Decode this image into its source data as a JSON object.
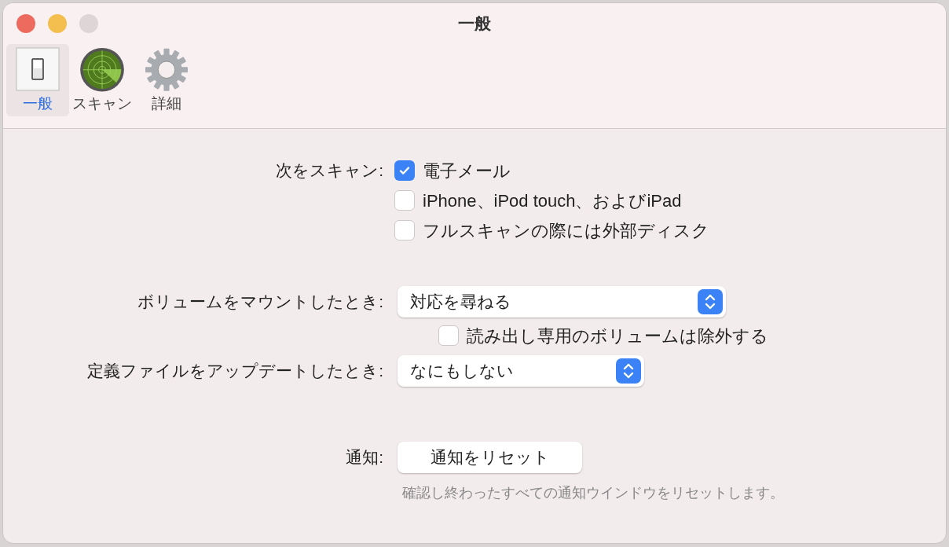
{
  "window": {
    "title": "一般"
  },
  "toolbar": [
    {
      "kind": "switch",
      "label": "一般",
      "selected": true
    },
    {
      "kind": "radar",
      "label": "スキャン",
      "selected": false
    },
    {
      "kind": "gear",
      "label": "詳細",
      "selected": false
    }
  ],
  "scan": {
    "label": "次をスキャン:",
    "options": [
      {
        "label": "電子メール",
        "checked": true
      },
      {
        "label": "iPhone、iPod touch、およびiPad",
        "checked": false
      },
      {
        "label": "フルスキャンの際には外部ディスク",
        "checked": false
      }
    ]
  },
  "mount": {
    "label": "ボリュームをマウントしたとき:",
    "popup": "対応を尋ねる",
    "exclude": {
      "label": "読み出し専用のボリュームは除外する",
      "checked": false
    }
  },
  "update": {
    "label": "定義ファイルをアップデートしたとき:",
    "popup": "なにもしない"
  },
  "notify": {
    "label": "通知:",
    "button": "通知をリセット",
    "hint": "確認し終わったすべての通知ウインドウをリセットします。"
  }
}
